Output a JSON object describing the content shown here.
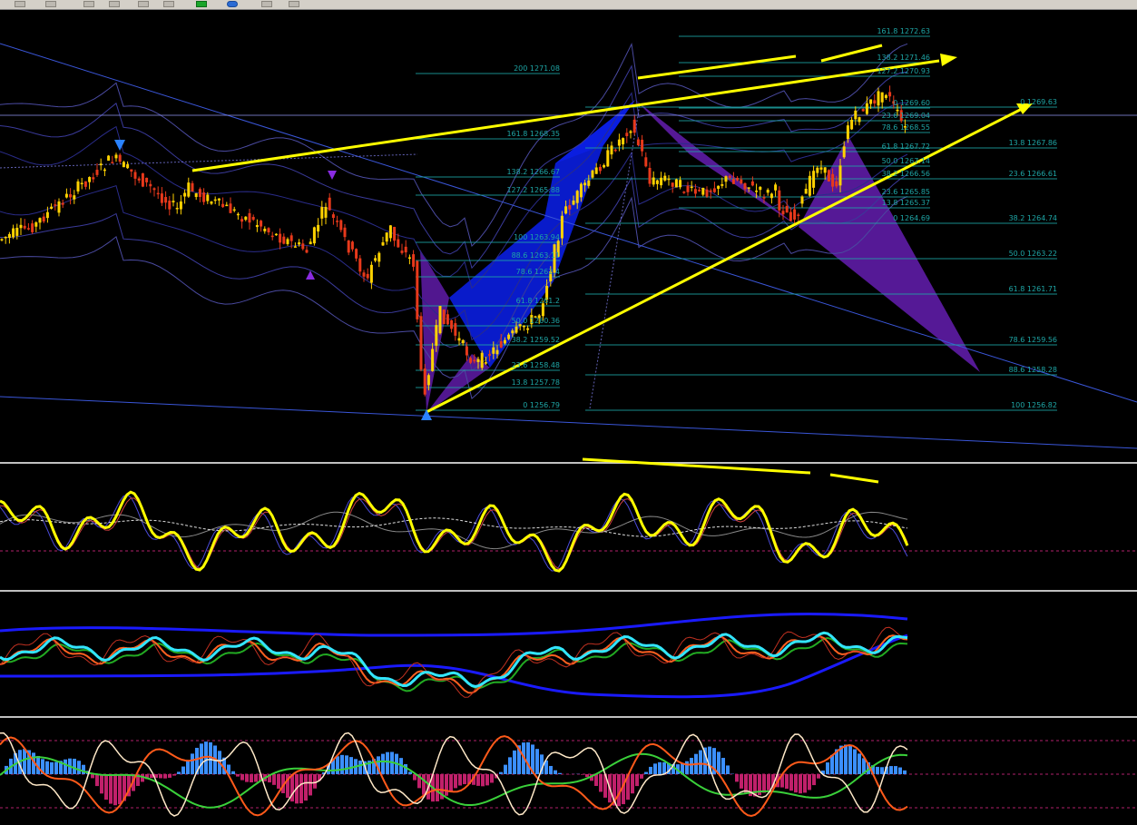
{
  "toolbar": {
    "buttons": [
      "toolbar-button-1",
      "toolbar-button-2",
      "toolbar-button-3",
      "toolbar-button-4",
      "toolbar-button-5",
      "toolbar-button-6",
      "toolbar-button-7",
      "toolbar-button-8"
    ]
  },
  "colors": {
    "background": "#000000",
    "bull_candle": "#ffd200",
    "bear_candle": "#e8391b",
    "fib_level": "#1ea5a5",
    "pattern_blue": "#0a1ee0",
    "pattern_purple": "#5a1a9e",
    "trendline": "#ffff00",
    "channel_line": "#3a56d8",
    "oscillator": "#ffff00",
    "ma_cyan": "#33e6ff",
    "histogram_up": "#3b8fff",
    "histogram_down": "#c0206a"
  },
  "fib_left": [
    {
      "pct": "200",
      "price": "1271.08"
    },
    {
      "pct": "161.8",
      "price": "1268.35"
    },
    {
      "pct": "138.2",
      "price": "1266.67"
    },
    {
      "pct": "127.2",
      "price": "1265.88"
    },
    {
      "pct": "100",
      "price": "1263.94"
    },
    {
      "pct": "88.6",
      "price": "1263.11"
    },
    {
      "pct": "78.6",
      "price": "1262.4"
    },
    {
      "pct": "61.8",
      "price": "1261.2"
    },
    {
      "pct": "50.0",
      "price": "1260.36"
    },
    {
      "pct": "38.2",
      "price": "1259.52"
    },
    {
      "pct": "23.6",
      "price": "1258.48"
    },
    {
      "pct": "13.8",
      "price": "1257.78"
    },
    {
      "pct": "0",
      "price": "1256.79"
    }
  ],
  "fib_top": [
    {
      "pct": "161.8",
      "price": "1272.63"
    },
    {
      "pct": "138.2",
      "price": "1271.46"
    },
    {
      "pct": "127.2",
      "price": "1270.93"
    },
    {
      "pct": "0",
      "price": "1269.60"
    },
    {
      "pct": "23.6",
      "price": "1269.04"
    },
    {
      "pct": "78.6",
      "price": "1268.55"
    },
    {
      "pct": "61.8",
      "price": "1267.72"
    },
    {
      "pct": "50.0",
      "price": "1267.14"
    },
    {
      "pct": "38.2",
      "price": "1266.56"
    },
    {
      "pct": "23.6",
      "price": "1265.85"
    },
    {
      "pct": "13.8",
      "price": "1265.37"
    },
    {
      "pct": "0",
      "price": "1264.69"
    }
  ],
  "fib_right": [
    {
      "pct": "0",
      "price": "1269.63"
    },
    {
      "pct": "13.8",
      "price": "1267.86"
    },
    {
      "pct": "23.6",
      "price": "1266.61"
    },
    {
      "pct": "38.2",
      "price": "1264.74"
    },
    {
      "pct": "50.0",
      "price": "1263.22"
    },
    {
      "pct": "61.8",
      "price": "1261.71"
    },
    {
      "pct": "78.6",
      "price": "1259.56"
    },
    {
      "pct": "88.6",
      "price": "1258.28"
    },
    {
      "pct": "100",
      "price": "1256.82"
    }
  ]
}
